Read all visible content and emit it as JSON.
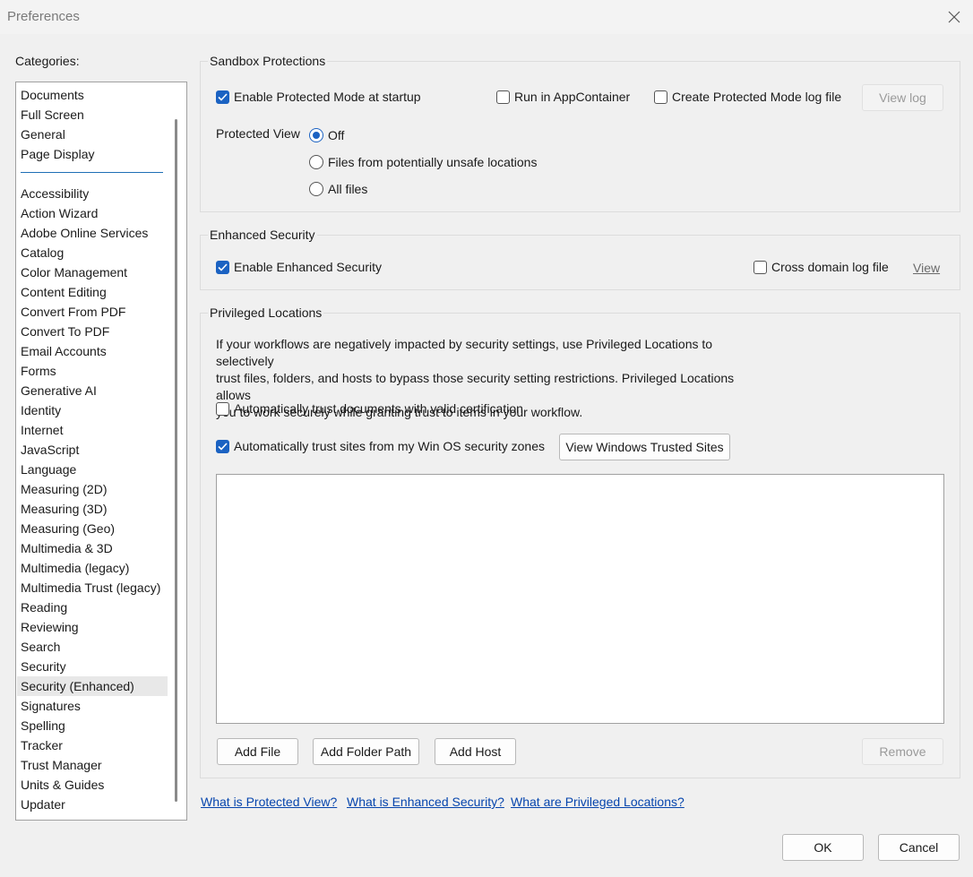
{
  "window": {
    "title": "Preferences"
  },
  "categories": {
    "label": "Categories:",
    "top_items": [
      "Documents",
      "Full Screen",
      "General",
      "Page Display"
    ],
    "items": [
      "Accessibility",
      "Action Wizard",
      "Adobe Online Services",
      "Catalog",
      "Color Management",
      "Content Editing",
      "Convert From PDF",
      "Convert To PDF",
      "Email Accounts",
      "Forms",
      "Generative AI",
      "Identity",
      "Internet",
      "JavaScript",
      "Language",
      "Measuring (2D)",
      "Measuring (3D)",
      "Measuring (Geo)",
      "Multimedia & 3D",
      "Multimedia (legacy)",
      "Multimedia Trust (legacy)",
      "Reading",
      "Reviewing",
      "Search",
      "Security",
      "Security (Enhanced)",
      "Signatures",
      "Spelling",
      "Tracker",
      "Trust Manager",
      "Units & Guides",
      "Updater"
    ],
    "selected": "Security (Enhanced)"
  },
  "sandbox": {
    "title": "Sandbox Protections",
    "protected_mode": {
      "label": "Enable Protected Mode at startup",
      "checked": true
    },
    "app_container": {
      "label": "Run in AppContainer",
      "checked": false
    },
    "log_file": {
      "label": "Create Protected Mode log file",
      "checked": false
    },
    "view_log": "View log",
    "protected_view_label": "Protected View",
    "protected_view_options": [
      "Off",
      "Files from potentially unsafe locations",
      "All files"
    ],
    "protected_view_selected": "Off"
  },
  "enhanced": {
    "title": "Enhanced Security",
    "enable": {
      "label": "Enable Enhanced Security",
      "checked": true
    },
    "cross_domain": {
      "label": "Cross domain log file",
      "checked": false
    },
    "view": "View"
  },
  "privileged": {
    "title": "Privileged Locations",
    "description_lines": [
      "If your workflows are negatively impacted by security settings, use Privileged Locations to selectively",
      "trust files, folders, and hosts to bypass those security setting restrictions. Privileged Locations allows",
      "you to work securely while granting trust to items in your workflow."
    ],
    "trust_cert": {
      "label": "Automatically trust documents with valid certification",
      "checked": false
    },
    "trust_sites": {
      "label": "Automatically trust sites from my Win OS security zones",
      "checked": true
    },
    "view_trusted_sites": "View Windows Trusted Sites",
    "add_file": "Add File",
    "add_folder": "Add Folder Path",
    "add_host": "Add Host",
    "remove": "Remove"
  },
  "help_links": [
    "What is Protected View?",
    "What is Enhanced Security?",
    "What are Privileged Locations?"
  ],
  "footer": {
    "ok": "OK",
    "cancel": "Cancel"
  },
  "colors": {
    "accent": "#1b62c2",
    "link": "#0645ad",
    "separator": "#1f6fb5"
  }
}
